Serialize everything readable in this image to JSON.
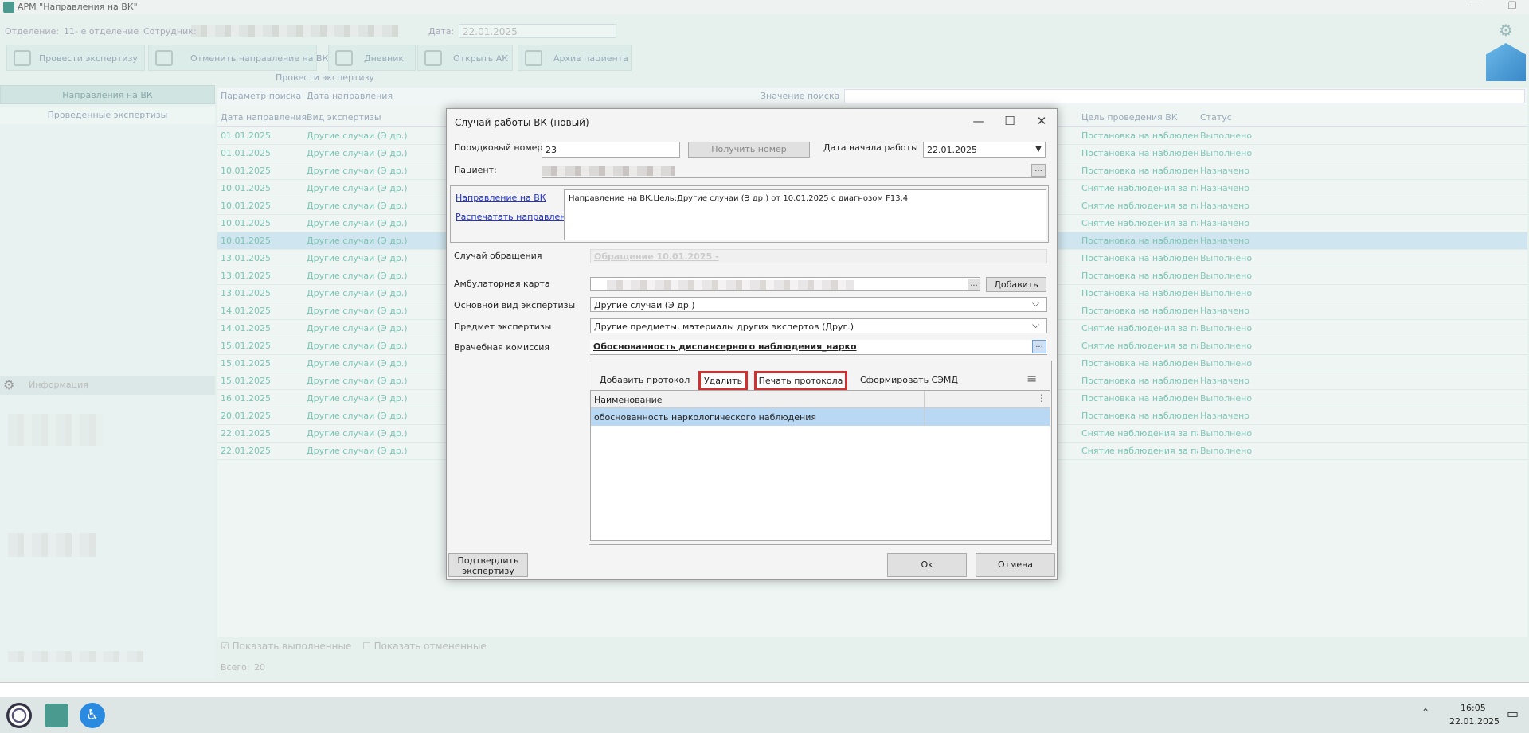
{
  "app": {
    "title": "АРМ \"Направления на ВК\""
  },
  "header": {
    "dept_label": "Отделение:",
    "dept_value": "11- е отделение",
    "employee_label": "Сотрудник:",
    "date_label": "Дата:",
    "date_value": "22.01.2025"
  },
  "toolbar": {
    "conduct": "Провести экспертизу",
    "cancel_ref": "Отменить направление на ВК",
    "diary": "Дневник",
    "open_ak": "Открыть АК",
    "archive": "Архив пациента",
    "group_caption": "Провести экспертизу"
  },
  "left": {
    "tab_refs": "Направления на ВК",
    "tab_done": "Проведенные экспертизы",
    "info": "Информация"
  },
  "search": {
    "param_label": "Параметр поиска",
    "param_value": "Дата направления",
    "value_label": "Значение поиска"
  },
  "grid": {
    "columns": [
      "Дата направления",
      "Вид экспертизы",
      "Цель проведения ВК",
      "Статус"
    ],
    "rows": [
      {
        "date": "01.01.2025",
        "kind": "Другие случаи (Э др.)",
        "goal": "Постановка на наблюдени...",
        "status": "Выполнено"
      },
      {
        "date": "01.01.2025",
        "kind": "Другие случаи (Э др.)",
        "goal": "Постановка на наблюдени...",
        "status": "Выполнено"
      },
      {
        "date": "10.01.2025",
        "kind": "Другие случаи (Э др.)",
        "goal": "Постановка на наблюдени...",
        "status": "Назначено"
      },
      {
        "date": "10.01.2025",
        "kind": "Другие случаи (Э др.)",
        "goal": "Снятие наблюдения за пац...",
        "status": "Назначено"
      },
      {
        "date": "10.01.2025",
        "kind": "Другие случаи (Э др.)",
        "goal": "Снятие наблюдения за пац...",
        "status": "Назначено"
      },
      {
        "date": "10.01.2025",
        "kind": "Другие случаи (Э др.)",
        "goal": "Снятие наблюдения за пац...",
        "status": "Назначено"
      },
      {
        "date": "10.01.2025",
        "kind": "Другие случаи (Э др.)",
        "goal": "Постановка на наблюдени...",
        "status": "Назначено"
      },
      {
        "date": "13.01.2025",
        "kind": "Другие случаи (Э др.)",
        "goal": "Постановка на наблюдени...",
        "status": "Выполнено"
      },
      {
        "date": "13.01.2025",
        "kind": "Другие случаи (Э др.)",
        "goal": "Постановка на наблюдени...",
        "status": "Выполнено"
      },
      {
        "date": "13.01.2025",
        "kind": "Другие случаи (Э др.)",
        "goal": "Постановка на наблюдени...",
        "status": "Выполнено"
      },
      {
        "date": "14.01.2025",
        "kind": "Другие случаи (Э др.)",
        "goal": "Постановка на наблюдени...",
        "status": "Назначено"
      },
      {
        "date": "14.01.2025",
        "kind": "Другие случаи (Э др.)",
        "goal": "Снятие наблюдения за пац...",
        "status": "Выполнено"
      },
      {
        "date": "15.01.2025",
        "kind": "Другие случаи (Э др.)",
        "goal": "Снятие наблюдения за пац...",
        "status": "Выполнено"
      },
      {
        "date": "15.01.2025",
        "kind": "Другие случаи (Э др.)",
        "goal": "Постановка на наблюдени...",
        "status": "Выполнено"
      },
      {
        "date": "15.01.2025",
        "kind": "Другие случаи (Э др.)",
        "goal": "Постановка на наблюдени...",
        "status": "Назначено"
      },
      {
        "date": "16.01.2025",
        "kind": "Другие случаи (Э др.)",
        "goal": "Постановка на наблюдени...",
        "status": "Выполнено"
      },
      {
        "date": "20.01.2025",
        "kind": "Другие случаи (Э др.)",
        "goal": "Постановка на наблюдени...",
        "status": "Назначено"
      },
      {
        "date": "22.01.2025",
        "kind": "Другие случаи (Э др.)",
        "goal": "Снятие наблюдения за пац...",
        "status": "Выполнено"
      },
      {
        "date": "22.01.2025",
        "kind": "Другие случаи (Э др.)",
        "goal": "Снятие наблюдения за пац...",
        "status": "Выполнено"
      }
    ],
    "show_done": "Показать выполненные",
    "show_canceled": "Показать отмененные",
    "total_label": "Всего:",
    "total": "20"
  },
  "dialog": {
    "title": "Случай работы ВК (новый)",
    "seq_label": "Порядковый номер",
    "seq_value": "23",
    "get_number": "Получить номер",
    "start_label": "Дата начала работы",
    "start_value": "22.01.2025",
    "patient_label": "Пациент:",
    "link_ref": "Направление на ВК",
    "link_print": "Распечатать направление",
    "ref_text": "Направление на ВК.Цель:Другие случаи (Э др.) от 10.01.2025 с диагнозом F13.4",
    "case_label": "Случай обращения",
    "case_value": "Обращение 10.01.2025 -",
    "amb_label": "Амбулаторная карта",
    "add": "Добавить",
    "kind_label": "Основной вид экспертизы",
    "kind_value": "Другие случаи (Э др.)",
    "subject_label": "Предмет экспертизы",
    "subject_value": "Другие предметы, материалы других экспертов (Друг.)",
    "commission_label": "Врачебная комиссия",
    "commission_value": "Обоснованность диспансерного наблюдения_нарко",
    "add_protocol": "Добавить протокол",
    "delete": "Удалить",
    "print_protocol": "Печать протокола",
    "form_semd": "Сформировать СЭМД",
    "col_name": "Наименование",
    "row_name": "обоснованность наркологического наблюдения",
    "confirm": "Подтвердить экспертизу",
    "ok": "Ok",
    "cancel": "Отмена",
    "ellipsis": "..."
  },
  "taskbar": {
    "time": "16:05",
    "date": "22.01.2025"
  },
  "colors": {
    "accent": "#4a9a90",
    "highlight_red": "#d03030",
    "selected_row": "#b8d8f4",
    "link": "#2233cc"
  }
}
